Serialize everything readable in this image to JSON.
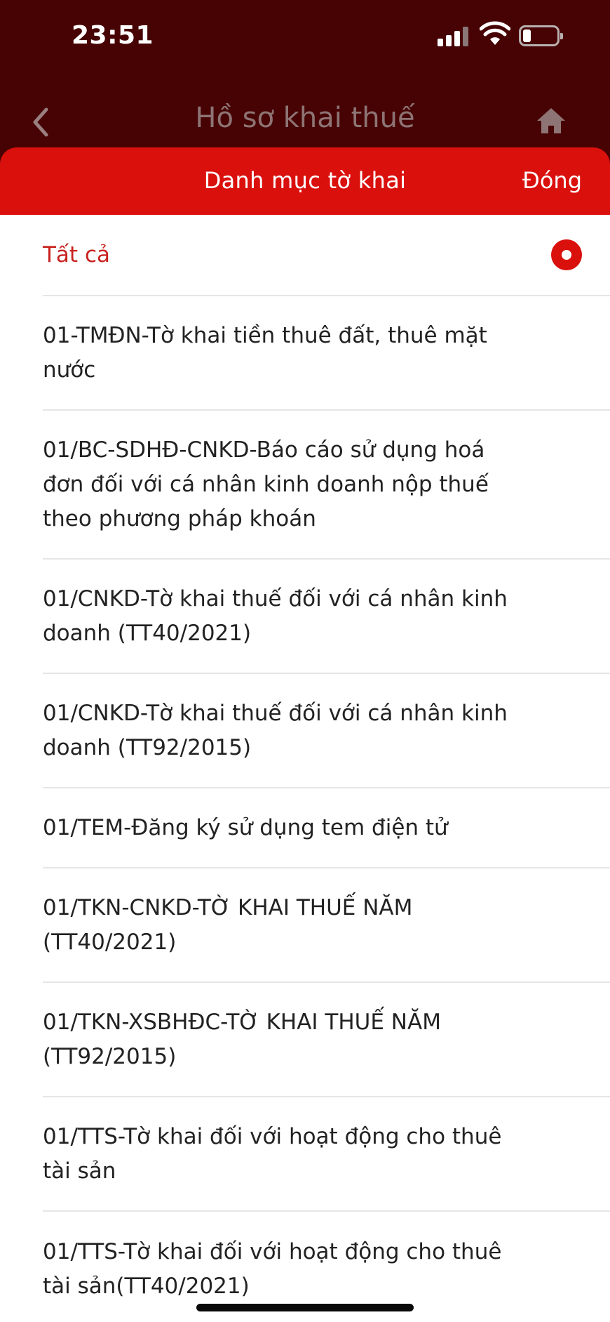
{
  "status": {
    "time": "23:51"
  },
  "nav": {
    "title": "Hồ sơ khai thuế"
  },
  "sheet": {
    "title": "Danh mục tờ khai",
    "close_label": "Đóng"
  },
  "list": {
    "selected_label": "Tất cả",
    "items": [
      "01-TMĐN-Tờ khai tiền thuê đất, thuê mặt nước",
      "01/BC-SDHĐ-CNKD-Báo cáo sử dụng hoá đơn đối với cá nhân kinh doanh nộp thuế theo phương pháp khoán",
      "01/CNKD-Tờ khai thuế đối với cá nhân kinh doanh (TT40/2021)",
      "01/CNKD-Tờ khai thuế đối với cá nhân kinh doanh (TT92/2015)",
      "01/TEM-Đăng ký sử dụng tem điện tử",
      "01/TKN-CNKD-TỜ KHAI THUẾ NĂM (TT40/2021)",
      "01/TKN-XSBHĐC-TỜ KHAI THUẾ NĂM (TT92/2015)",
      "01/TTS-Tờ khai đối với hoạt động cho thuê tài sản",
      "01/TTS-Tờ khai đối với hoạt động cho thuê tài sản(TT40/2021)"
    ]
  },
  "colors": {
    "header_dark": "#470304",
    "accent_red": "#da100d",
    "selected_text": "#c8221f"
  },
  "icons": [
    "back-chevron-icon",
    "home-icon",
    "signal-icon",
    "wifi-icon",
    "battery-icon",
    "radio-selected-icon"
  ]
}
